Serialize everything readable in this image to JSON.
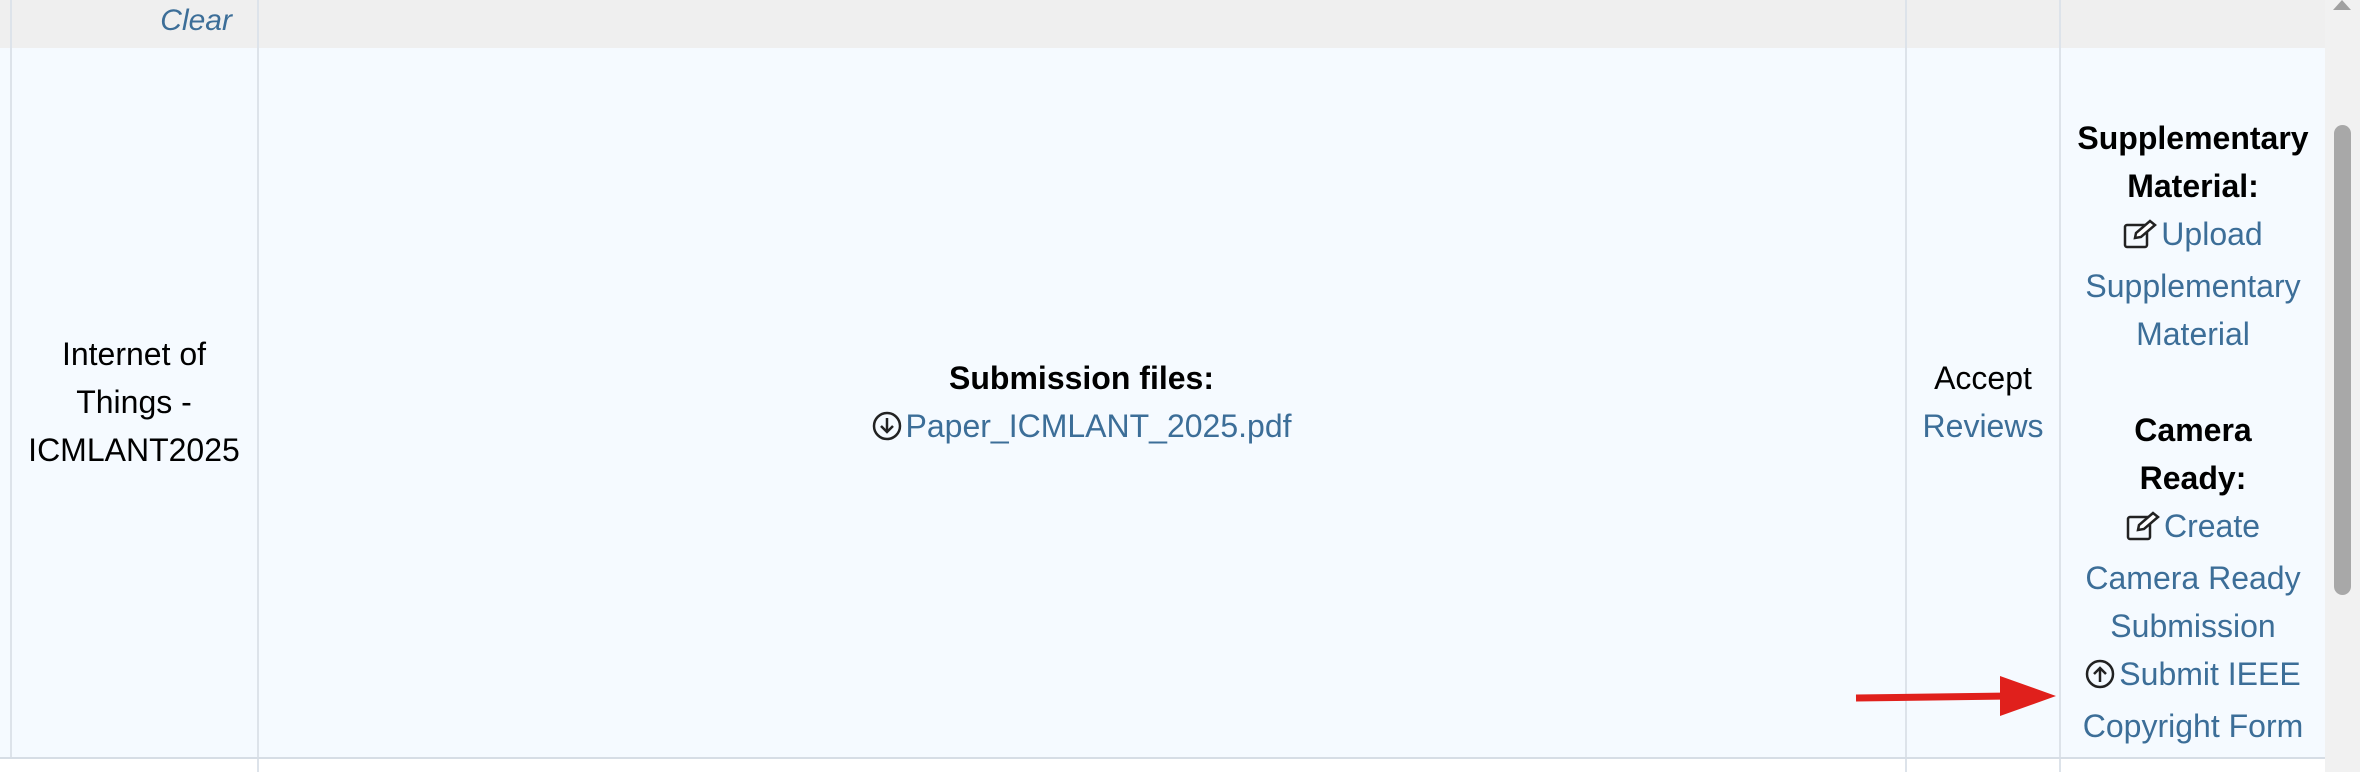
{
  "header": {
    "clear_label": "Clear"
  },
  "row": {
    "track_lines": [
      "Internet of",
      "Things -",
      "ICMLANT2025"
    ],
    "files": {
      "heading": "Submission files:",
      "file_link": "Paper_ICMLANT_2025.pdf"
    },
    "status": {
      "decision": "Accept",
      "reviews_link": "Reviews"
    },
    "actions": {
      "supp_heading_lines": [
        "Supplementary",
        "Material:"
      ],
      "upload_link_lines": [
        "Upload",
        "Supplementary",
        "Material"
      ],
      "camera_heading_lines": [
        "Camera",
        "Ready:"
      ],
      "create_link_lines": [
        "Create",
        "Camera Ready",
        "Submission"
      ],
      "copyright_link_lines": [
        "Submit IEEE",
        "Copyright Form"
      ]
    }
  },
  "colors": {
    "link": "#3c6e98",
    "arrow": "#e0201c",
    "row_bg": "#f5faff",
    "header_bg": "#efefef"
  },
  "icons": [
    "download-circle-icon",
    "edit-icon",
    "upload-circle-icon",
    "red-arrow-annotation"
  ]
}
